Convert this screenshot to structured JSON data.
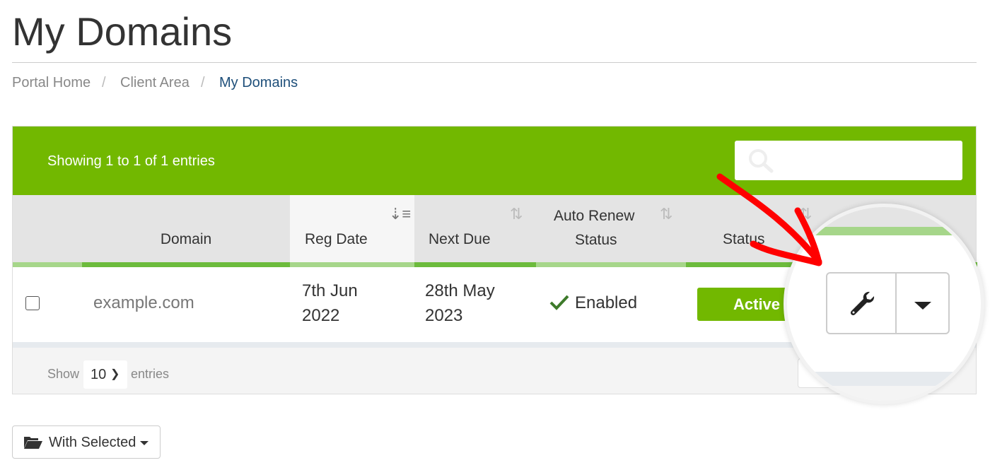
{
  "page": {
    "title": "My Domains"
  },
  "breadcrumb": [
    "Portal Home",
    "Client Area",
    "My Domains"
  ],
  "table": {
    "info": "Showing 1 to 1 of 1 entries",
    "search_placeholder": "",
    "columns": [
      "Domain",
      "Reg Date",
      "Next Due",
      "Auto Renew Status",
      "Status"
    ],
    "columns_split": {
      "auto_renew_1": "Auto Renew",
      "auto_renew_2": "Status"
    },
    "rows": [
      {
        "domain": "example.com",
        "reg_date_1": "7th Jun",
        "reg_date_2": "2022",
        "next_due_1": "28th May",
        "next_due_2": "2023",
        "auto_renew": "Enabled",
        "status": "Active"
      }
    ],
    "length": {
      "show": "Show",
      "value": "10",
      "entries": "entries"
    }
  },
  "with_selected": "With Selected",
  "colors": {
    "brand_green": "#72b800",
    "annotation_red": "#ff0000",
    "status_active": "#72b800",
    "check": "#3d7a2a"
  },
  "icons": [
    "search-icon",
    "sort-icon",
    "check-icon",
    "wrench-icon",
    "caret-down-icon",
    "folder-open-icon",
    "chevron-down-icon"
  ]
}
